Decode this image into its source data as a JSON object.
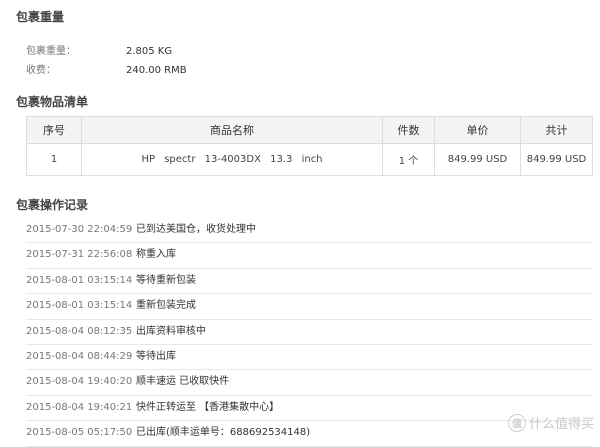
{
  "weight_section": {
    "title": "包裹重量",
    "rows": [
      {
        "key": "包裹重量：",
        "value": "2.805 KG"
      },
      {
        "key": "收费：",
        "value": "240.00 RMB"
      }
    ]
  },
  "items_section": {
    "title": "包裹物品清单",
    "headers": [
      "序号",
      "商品名称",
      "件数",
      "单价",
      "共计"
    ],
    "rows": [
      [
        "1",
        "HP spectr 13-4003DX 13.3 inch",
        "1 个",
        "849.99 USD",
        "849.99 USD"
      ]
    ]
  },
  "log_section": {
    "title": "包裹操作记录",
    "rows": [
      {
        "time": "2015-07-30 22:04:59",
        "desc": "已到达美国仓，收货处理中"
      },
      {
        "time": "2015-07-31 22:56:08",
        "desc": "称重入库"
      },
      {
        "time": "2015-08-01 03:15:14",
        "desc": "等待重新包装"
      },
      {
        "time": "2015-08-01 03:15:14",
        "desc": "重新包装完成"
      },
      {
        "time": "2015-08-04 08:12:35",
        "desc": "出库资料审核中"
      },
      {
        "time": "2015-08-04 08:44:29",
        "desc": "等待出库"
      },
      {
        "time": "2015-08-04 19:40:20",
        "desc": "顺丰速运 已收取快件"
      },
      {
        "time": "2015-08-04 19:40:21",
        "desc": "快件正转运至 【香港集散中心】"
      },
      {
        "time": "2015-08-05 05:17:50",
        "desc": "已出库(顺丰运单号：688692534148)"
      }
    ]
  },
  "watermark": {
    "badge": "值",
    "text": "什么值得买"
  }
}
